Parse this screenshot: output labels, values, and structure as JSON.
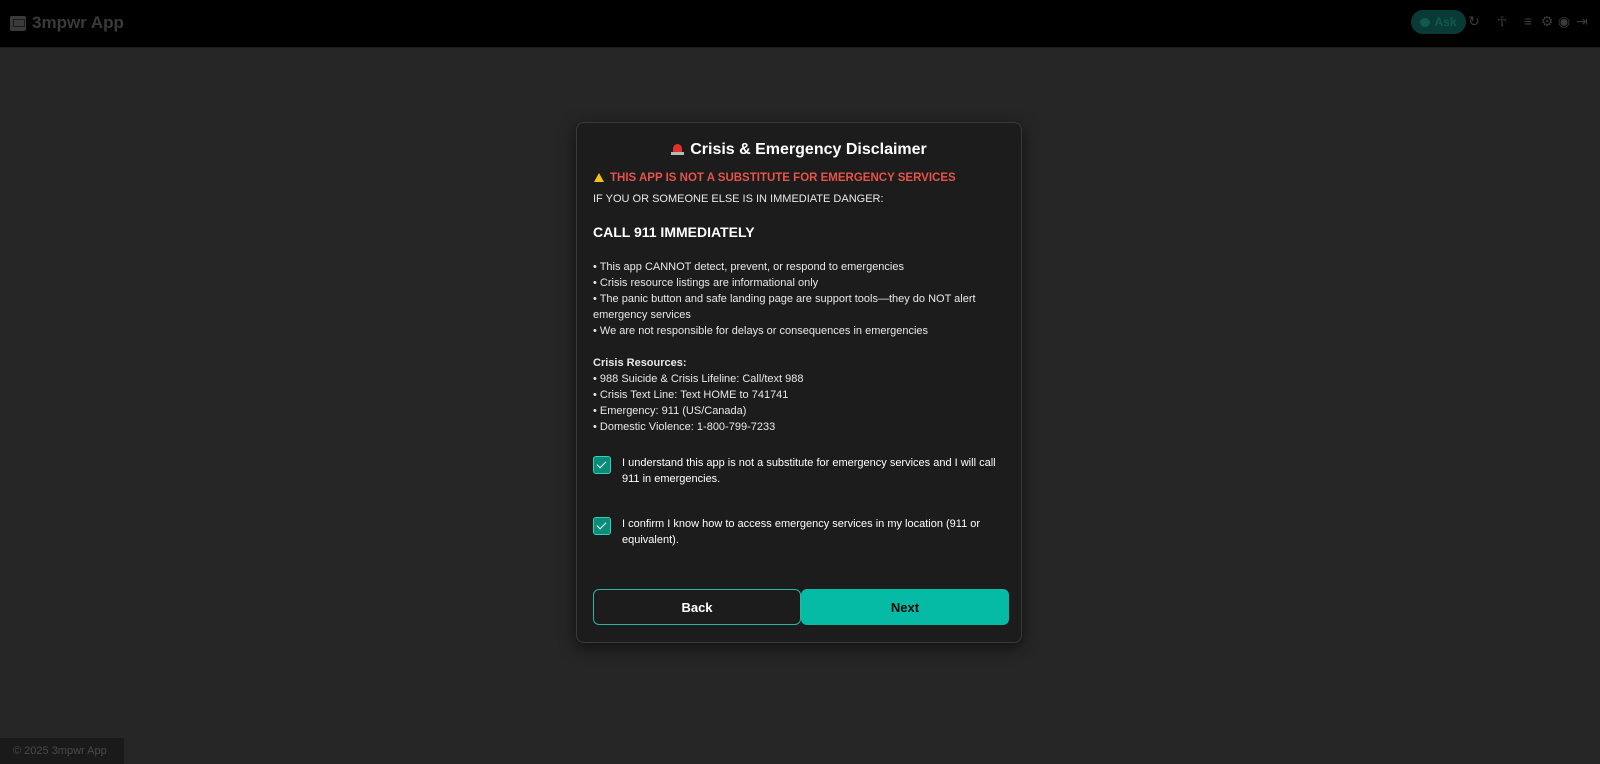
{
  "header": {
    "app_title": "3mpwr App",
    "ask_label": "Ask",
    "icons": [
      "chat-icon",
      "refresh-icon",
      "accessibility-icon",
      "menu-icon",
      "gear-icon",
      "user-icon",
      "logout-icon"
    ]
  },
  "modal": {
    "title": "Crisis & Emergency Disclaimer",
    "warning": "THIS APP IS NOT A SUBSTITUTE FOR EMERGENCY SERVICES",
    "danger_line": "IF YOU OR SOMEONE ELSE IS IN IMMEDIATE DANGER:",
    "call_line": "CALL 911 IMMEDIATELY",
    "bullets": [
      "• This app CANNOT detect, prevent, or respond to emergencies",
      "• Crisis resource listings are informational only",
      "• The panic button and safe landing page are support tools—they do NOT alert emergency services",
      "• We are not responsible for delays or consequences in emergencies"
    ],
    "resources_title": "Crisis Resources:",
    "resources": [
      "• 988 Suicide & Crisis Lifeline: Call/text 988",
      "• Crisis Text Line: Text HOME to 741741",
      "• Emergency: 911 (US/Canada)",
      "• Domestic Violence: 1-800-799-7233"
    ],
    "checkboxes": [
      {
        "label": "I understand this app is not a substitute for emergency services and I will call 911 in emergencies.",
        "checked": true
      },
      {
        "label": "I confirm I know how to access emergency services in my location (911 or equivalent).",
        "checked": true
      }
    ],
    "back_label": "Back",
    "next_label": "Next"
  },
  "footer": {
    "text": "© 2025 3mpwr App"
  },
  "colors": {
    "accent": "#05bba5",
    "warning_red": "#e5534b",
    "background": "#262626",
    "modal_bg": "#1c1c1c"
  }
}
